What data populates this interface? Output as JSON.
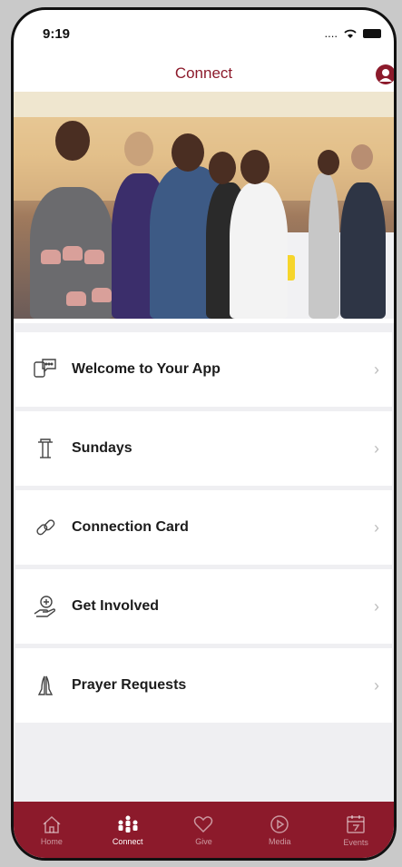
{
  "status": {
    "time": "9:19",
    "signal": "....",
    "wifi_icon": "wifi-icon",
    "battery_icon": "battery-icon"
  },
  "header": {
    "title": "Connect",
    "profile_icon": "person-icon"
  },
  "colors": {
    "brand": "#8c1a2b",
    "background": "#efeff2",
    "chevron": "#bdbdbd"
  },
  "menu": {
    "items": [
      {
        "label": "Welcome to Your App",
        "icon": "chat-bubbles-icon"
      },
      {
        "label": "Sundays",
        "icon": "podium-icon"
      },
      {
        "label": "Connection Card",
        "icon": "link-icon"
      },
      {
        "label": "Get Involved",
        "icon": "hand-gift-icon"
      },
      {
        "label": "Prayer Requests",
        "icon": "praying-hands-icon"
      }
    ]
  },
  "tabs": [
    {
      "label": "Home",
      "icon": "home-icon",
      "active": false
    },
    {
      "label": "Connect",
      "icon": "people-icon",
      "active": true
    },
    {
      "label": "Give",
      "icon": "heart-icon",
      "active": false
    },
    {
      "label": "Media",
      "icon": "play-icon",
      "active": false
    },
    {
      "label": "Events",
      "icon": "calendar-icon",
      "active": false
    }
  ]
}
